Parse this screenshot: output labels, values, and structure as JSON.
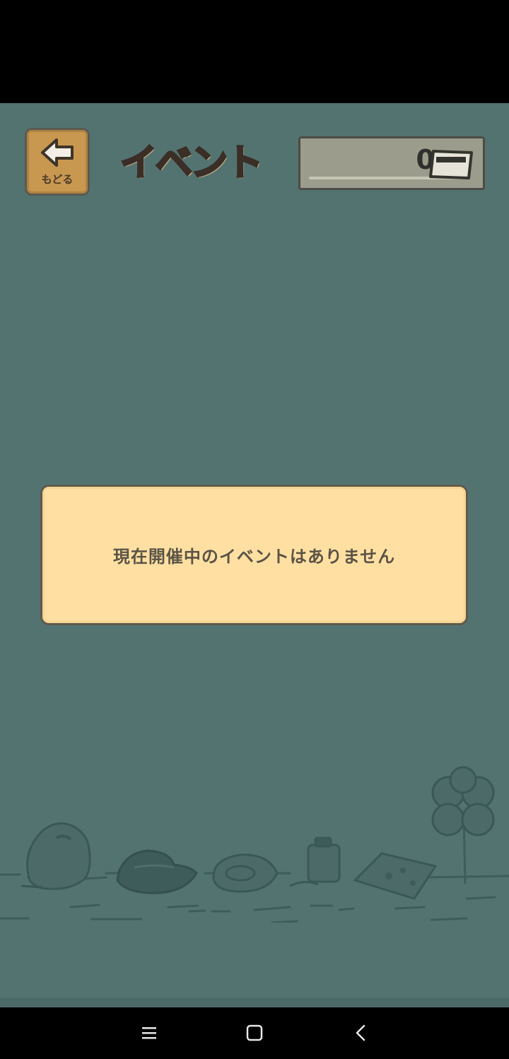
{
  "header": {
    "back_label": "もどる",
    "title": "イベント",
    "currency_value": "0"
  },
  "message": {
    "text": "現在開催中のイベントはありません"
  },
  "icons": {
    "back": "left-arrow-icon",
    "currency": "ticket-card-icon"
  },
  "colors": {
    "background": "#537371",
    "message_box": "#ffe0a2",
    "back_button": "#c99850",
    "currency_box": "#9b9c8b"
  },
  "navbar": {
    "buttons": [
      "menu",
      "home",
      "back"
    ]
  }
}
